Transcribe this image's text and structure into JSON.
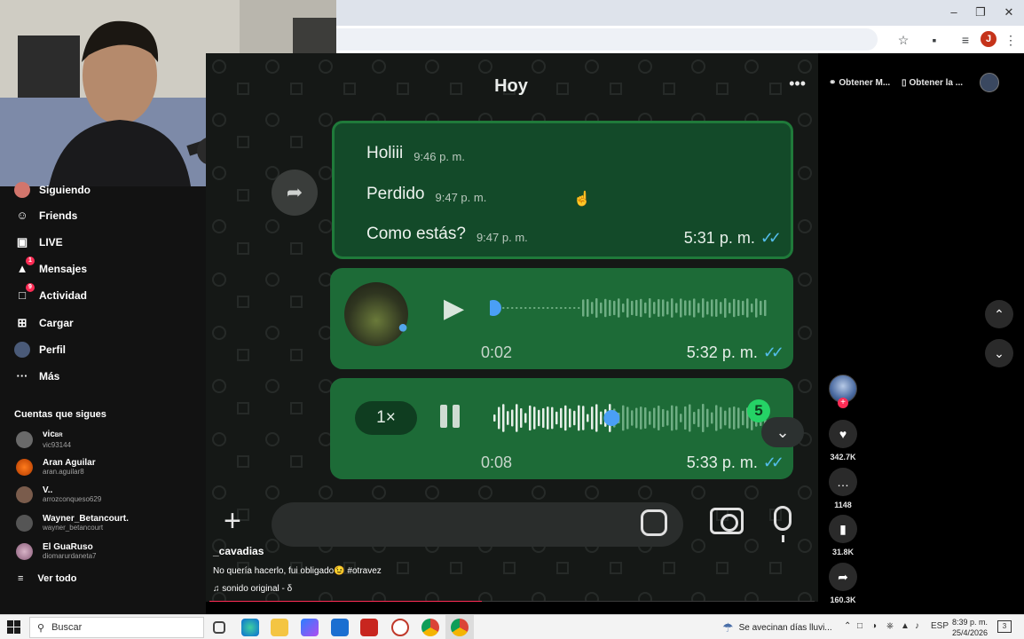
{
  "sidebar": {
    "items": [
      {
        "label": "Siguiendo",
        "icon": "avatar-icon"
      },
      {
        "label": "Friends",
        "icon": "friends-icon"
      },
      {
        "label": "LIVE",
        "icon": "live-icon"
      },
      {
        "label": "Mensajes",
        "icon": "send-icon",
        "badge": "1"
      },
      {
        "label": "Actividad",
        "icon": "activity-icon",
        "badge": "9"
      },
      {
        "label": "Cargar",
        "icon": "upload-icon"
      },
      {
        "label": "Perfil",
        "icon": "profile-icon"
      },
      {
        "label": "Más",
        "icon": "more-icon"
      }
    ],
    "following_title": "Cuentas que sigues",
    "following": [
      {
        "name": "vic",
        "suffix": "BR",
        "handle": "vic93144"
      },
      {
        "name": "Aran Aguilar",
        "handle": "aran.aguilar8"
      },
      {
        "name": "V..",
        "handle": "arrozconqueso629"
      },
      {
        "name": "Wayner_Betancourt.",
        "handle": "wayner_betancourt"
      },
      {
        "name": "El GuaRuso",
        "handle": "diomarurdaneta7"
      }
    ],
    "see_all": "Ver todo"
  },
  "header": {
    "ext1": "Obtener M...",
    "ext2": "Obtener la ...",
    "profile_initial": "J"
  },
  "video": {
    "chat_date": "Hoy",
    "quoted": [
      {
        "text": "Holiii",
        "time": "9:46 p. m."
      },
      {
        "text": "Perdido",
        "time": "9:47 p. m."
      },
      {
        "text": "Como estás?",
        "time": "9:47 p. m."
      }
    ],
    "quote_time": "5:31 p. m.",
    "voice1": {
      "duration": "0:02",
      "time": "5:32 p. m.",
      "progress": 0.0
    },
    "voice2": {
      "speed": "1×",
      "duration": "0:08",
      "time": "5:33 p. m.",
      "badge": "5",
      "progress": 0.43
    },
    "author": "_cavadias",
    "caption": "No quería hacerlo, fui obligado😉 #otravez",
    "music": "sonido original - δ",
    "progress": 0.45
  },
  "actions": {
    "likes": "342.7K",
    "comments": "1148",
    "saves": "31.8K",
    "shares": "160.3K"
  },
  "taskbar": {
    "search_placeholder": "Buscar",
    "weather": "Se avecinan días lluvi...",
    "language": "ESP",
    "time": "8:39 p. m.",
    "date": "25/4/2026",
    "notifications": "3"
  },
  "colors": {
    "accent": "#fe2c55",
    "bubble": "#1d6b37",
    "ticks": "#53bdeb"
  }
}
